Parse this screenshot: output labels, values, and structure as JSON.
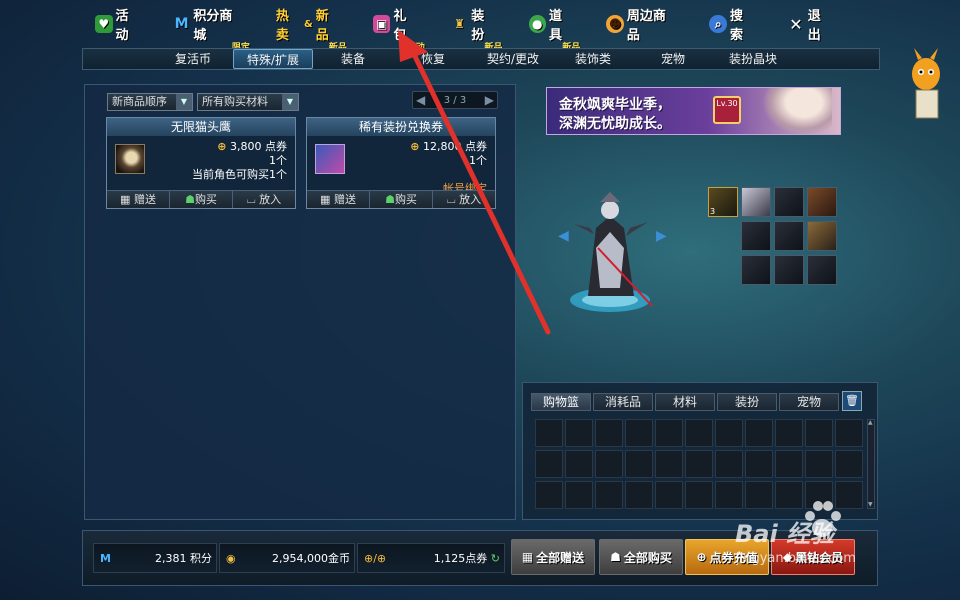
{
  "nav": {
    "items": [
      {
        "label": "活动",
        "sub": "",
        "icon": "gift-icon"
      },
      {
        "label": "积分商城",
        "sub": "限定",
        "icon": "m-logo-icon"
      },
      {
        "label": "热卖",
        "label2": "新品",
        "sub": "新品",
        "icon": ""
      },
      {
        "label": "礼包",
        "sub": "活动",
        "icon": "present-icon"
      },
      {
        "label": "装扮",
        "sub": "新品",
        "icon": "trophy-icon"
      },
      {
        "label": "道具",
        "sub": "新品",
        "icon": "potion-icon"
      },
      {
        "label": "周边商品",
        "sub": "",
        "icon": "mascot-face-icon"
      },
      {
        "label": "搜索",
        "sub": "",
        "icon": "magnifier-icon"
      },
      {
        "label": "退出",
        "sub": "",
        "icon": "close-icon"
      }
    ]
  },
  "categories": [
    "复活币",
    "特殊/扩展",
    "装备",
    "恢复",
    "契约/更改",
    "装饰类",
    "宠物",
    "装扮晶块"
  ],
  "active_category": "特殊/扩展",
  "filters": {
    "sort": "新商品顺序",
    "material": "所有购买材料"
  },
  "pager": {
    "text": "3 / 3"
  },
  "products": [
    {
      "name": "无限猫头鹰",
      "price": "3,800",
      "unit": "点券",
      "count": "1个",
      "note": "当前角色可购买1个",
      "actions": [
        "赠送",
        "购买",
        "放入"
      ]
    },
    {
      "name": "稀有装扮兑换券",
      "price": "12,800",
      "unit": "点券",
      "count": "1个",
      "note": "帐号绑定",
      "actions": [
        "赠送",
        "购买",
        "放入"
      ]
    }
  ],
  "banner": {
    "line1": "金秋飒爽毕业季，",
    "line2": "深渊无忧助成长。",
    "badge": "Lv.30"
  },
  "equip_slots": {
    "first_count": "3"
  },
  "bag": {
    "tabs": [
      "购物篮",
      "消耗品",
      "材料",
      "装扮",
      "宠物"
    ],
    "active": "购物篮",
    "columns": 11,
    "rows": 3
  },
  "currency": {
    "points": "2,381 积分",
    "gold": "2,954,000金币",
    "cash_icon": "点券/代币券",
    "cash": "1,125点券"
  },
  "bottom_buttons": [
    "全部赠送",
    "全部购买",
    "点券充值",
    "黑钻会员"
  ],
  "watermark": {
    "main": "Bai 经验",
    "url": "jingyan.baidu.com"
  },
  "colors": {
    "accent_gold": "#f2b83a",
    "bag_active": "#46586a",
    "arrow": "#e0312a"
  }
}
